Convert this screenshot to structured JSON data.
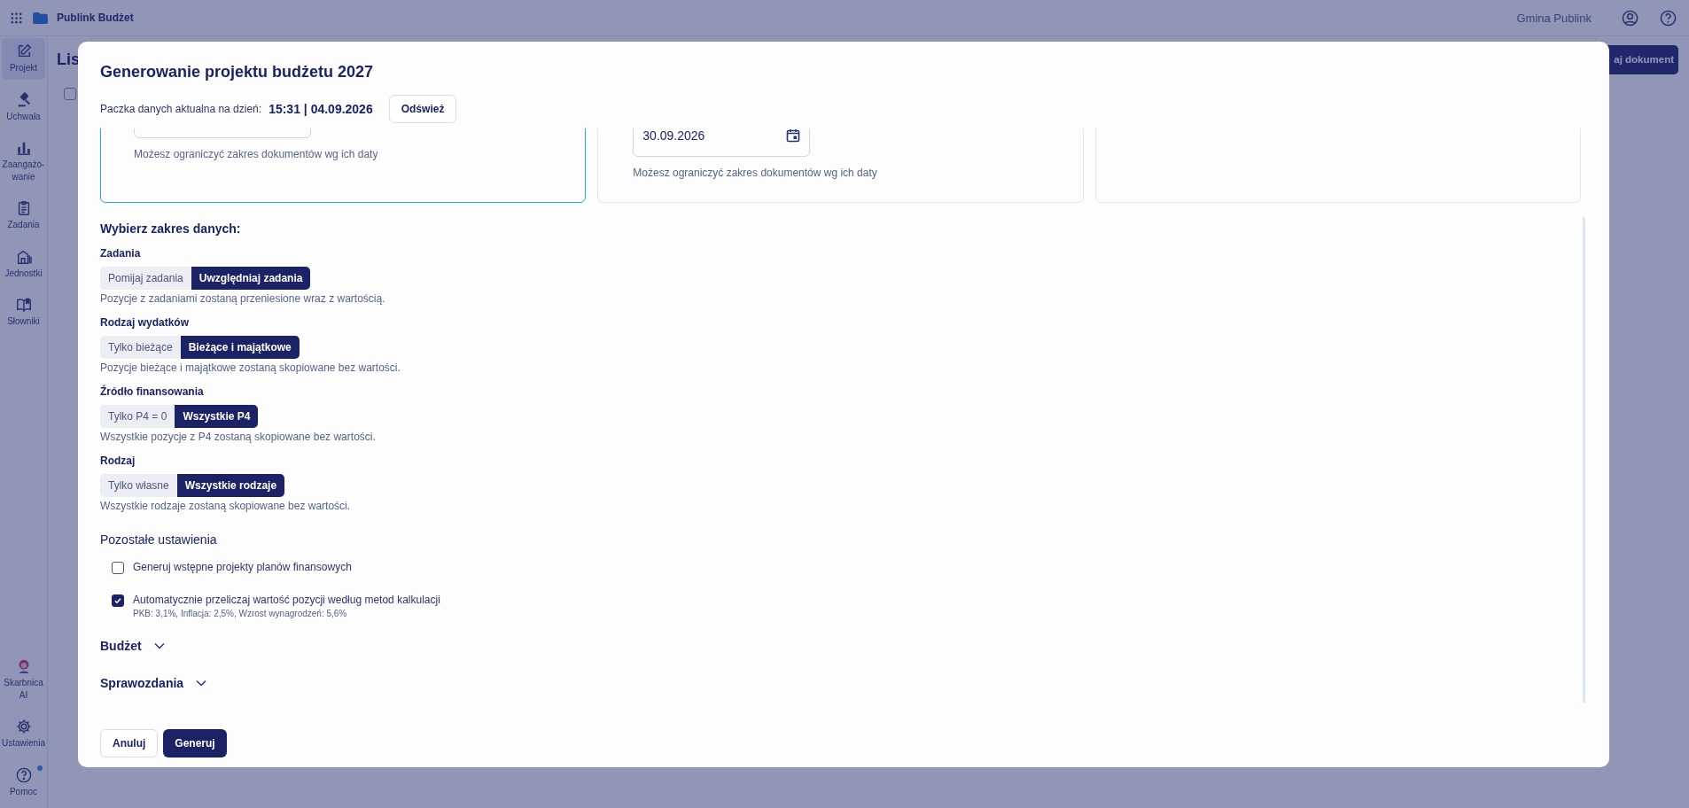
{
  "app": {
    "name": "Publink Budżet",
    "organization": "Gmina Publink"
  },
  "sidebar": {
    "items": [
      {
        "label": "Projekt",
        "kind": "edit",
        "selected": true
      },
      {
        "label": "Uchwała",
        "kind": "gavel",
        "selected": false
      },
      {
        "label": "Zaangażo-wanie",
        "kind": "chart",
        "selected": false
      },
      {
        "label": "Zadania",
        "kind": "clipboard",
        "selected": false
      },
      {
        "label": "Jednostki",
        "kind": "building",
        "selected": false
      },
      {
        "label": "Słowniki",
        "kind": "book",
        "selected": false
      }
    ],
    "bottom_items": [
      {
        "label": "Skarbnica AI",
        "kind": "avatar",
        "badge": false
      },
      {
        "label": "Ustawienia",
        "kind": "gear",
        "badge": false
      },
      {
        "label": "Pomoc",
        "kind": "help",
        "badge": true
      }
    ]
  },
  "page": {
    "title": "Lis",
    "action_button": "aj dokument",
    "select_all_checked": false
  },
  "dialog": {
    "title": "Generowanie projektu budżetu 2027",
    "data_package": {
      "label": "Paczka danych aktualna na dzień:",
      "value": "15:31 | 04.09.2026",
      "refresh_button": "Odśwież"
    },
    "date_cards": [
      {
        "selected": true,
        "hint": "Możesz ograniczyć zakres dokumentów wg ich daty"
      },
      {
        "selected": false,
        "value": "30.09.2026",
        "hint": "Możesz ograniczyć zakres dokumentów wg ich daty"
      },
      {
        "selected": false
      }
    ],
    "scope": {
      "title": "Wybierz zakres danych:",
      "groups": [
        {
          "label": "Zadania",
          "options": [
            {
              "label": "Pomijaj zadania",
              "selected": false
            },
            {
              "label": "Uwzględniaj zadania",
              "selected": true
            }
          ],
          "description": "Pozycje z zadaniami zostaną przeniesione wraz z wartością."
        },
        {
          "label": "Rodzaj wydatków",
          "options": [
            {
              "label": "Tylko bieżące",
              "selected": false
            },
            {
              "label": "Bieżące i majątkowe",
              "selected": true
            }
          ],
          "description": "Pozycje bieżące i majątkowe zostaną skopiowane bez wartości."
        },
        {
          "label": "Źródło finansowania",
          "options": [
            {
              "label": "Tylko P4 = 0",
              "selected": false
            },
            {
              "label": "Wszystkie P4",
              "selected": true
            }
          ],
          "description": "Wszystkie pozycje z P4 zostaną skopiowane bez wartości."
        },
        {
          "label": "Rodzaj",
          "options": [
            {
              "label": "Tylko własne",
              "selected": false
            },
            {
              "label": "Wszystkie rodzaje",
              "selected": true
            }
          ],
          "description": "Wszystkie rodzaje zostaną skopiowane bez wartości."
        }
      ]
    },
    "other_settings": {
      "title": "Pozostałe ustawienia",
      "options": [
        {
          "label": "Generuj wstępne projekty planów finansowych",
          "checked": false
        },
        {
          "label": "Automatycznie przeliczaj wartość pozycji według metod kalkulacji",
          "checked": true,
          "note": "PKB: 3,1%, Inflacja: 2,5%, Wzrost wynagrodzeń: 5,6%"
        }
      ]
    },
    "sections": [
      {
        "label": "Budżet",
        "expanded": false
      },
      {
        "label": "Sprawozdania",
        "expanded": false
      }
    ],
    "buttons": {
      "cancel": "Anuluj",
      "submit": "Generuj"
    }
  }
}
